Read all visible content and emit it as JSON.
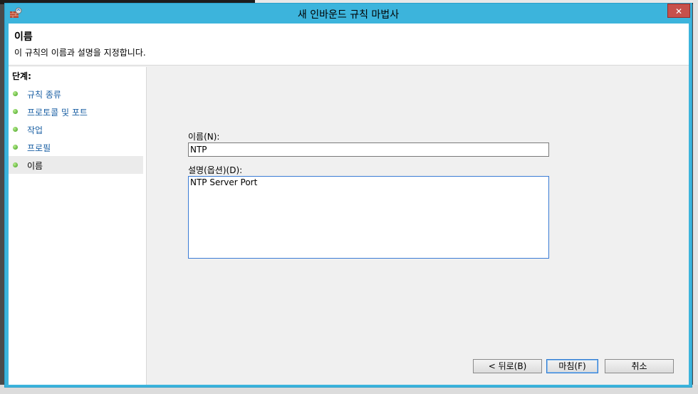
{
  "window": {
    "title": "새 인바운드 규칙 마법사",
    "close_label": "✕"
  },
  "header": {
    "title": "이름",
    "description": "이 규칙의 이름과 설명을 지정합니다."
  },
  "sidebar": {
    "steps_label": "단계:",
    "items": [
      {
        "label": "규칙 종류"
      },
      {
        "label": "프로토콜 및 포트"
      },
      {
        "label": "작업"
      },
      {
        "label": "프로필"
      },
      {
        "label": "이름"
      }
    ]
  },
  "form": {
    "name_label": "이름(N):",
    "name_value": "NTP",
    "description_label": "설명(옵션)(D):",
    "description_value": "NTP Server Port"
  },
  "buttons": {
    "back": "< 뒤로(B)",
    "finish": "마침(F)",
    "cancel": "취소"
  },
  "colors": {
    "title_bar": "#3cb4dc",
    "step_dot": "#3d9b1b",
    "step_link": "#1a5fa3",
    "close_button": "#c7504b"
  }
}
